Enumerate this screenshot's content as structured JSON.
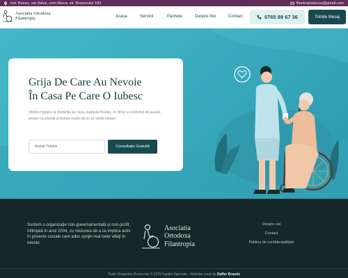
{
  "topbar": {
    "address": "Jud. Buzau, sat Satuc, com Berca, str. Brasovului 183",
    "email": "filantropiaberca@gmail.com",
    "background": "#5e2d56"
  },
  "header": {
    "logo_line1": "Asociatia Ortodoxa",
    "logo_line2": "Filantropia",
    "nav": [
      "Acasa",
      "Servicii",
      "Pachete",
      "Despre Noi",
      "Contact"
    ],
    "phone": "0765 89 67 36",
    "message_button": "Trimite Mesaj"
  },
  "hero": {
    "title_line1": "Grija De Care Au Nevoie",
    "title_line2": "În Casa Pe Care O Iubesc",
    "description": "Oferim îngrijire la domiciliu pe raza Județului Buzău, în ritmul și confortul de acasă, pentru ca părinții și bunicii noștri să nu se simtă singuri.",
    "phone_placeholder": "Număr Telefon",
    "consult_button": "Consultație Gratuită",
    "accent": "#3fb2c4"
  },
  "footer": {
    "about": "Suntem o organizaţie non-guvernamentală şi non-profit, înfiinţată în anul 2004, cu misiunea de a se implica activ în proiecte sociale care aduc sprijin real celor aflaţi în nevoie.",
    "logo_line1": "Asociatia",
    "logo_line2": "Ortodoxa",
    "logo_line3": "Filantropia",
    "links": [
      "Despre noi",
      "Contact",
      "Politica de confidențialitate"
    ],
    "copyright_prefix": "Toate Drepturile Rezervate © 2025 Îngrijiri Speciale - Website creat de ",
    "copyright_author": "Daffer Brands",
    "background": "#152827"
  }
}
